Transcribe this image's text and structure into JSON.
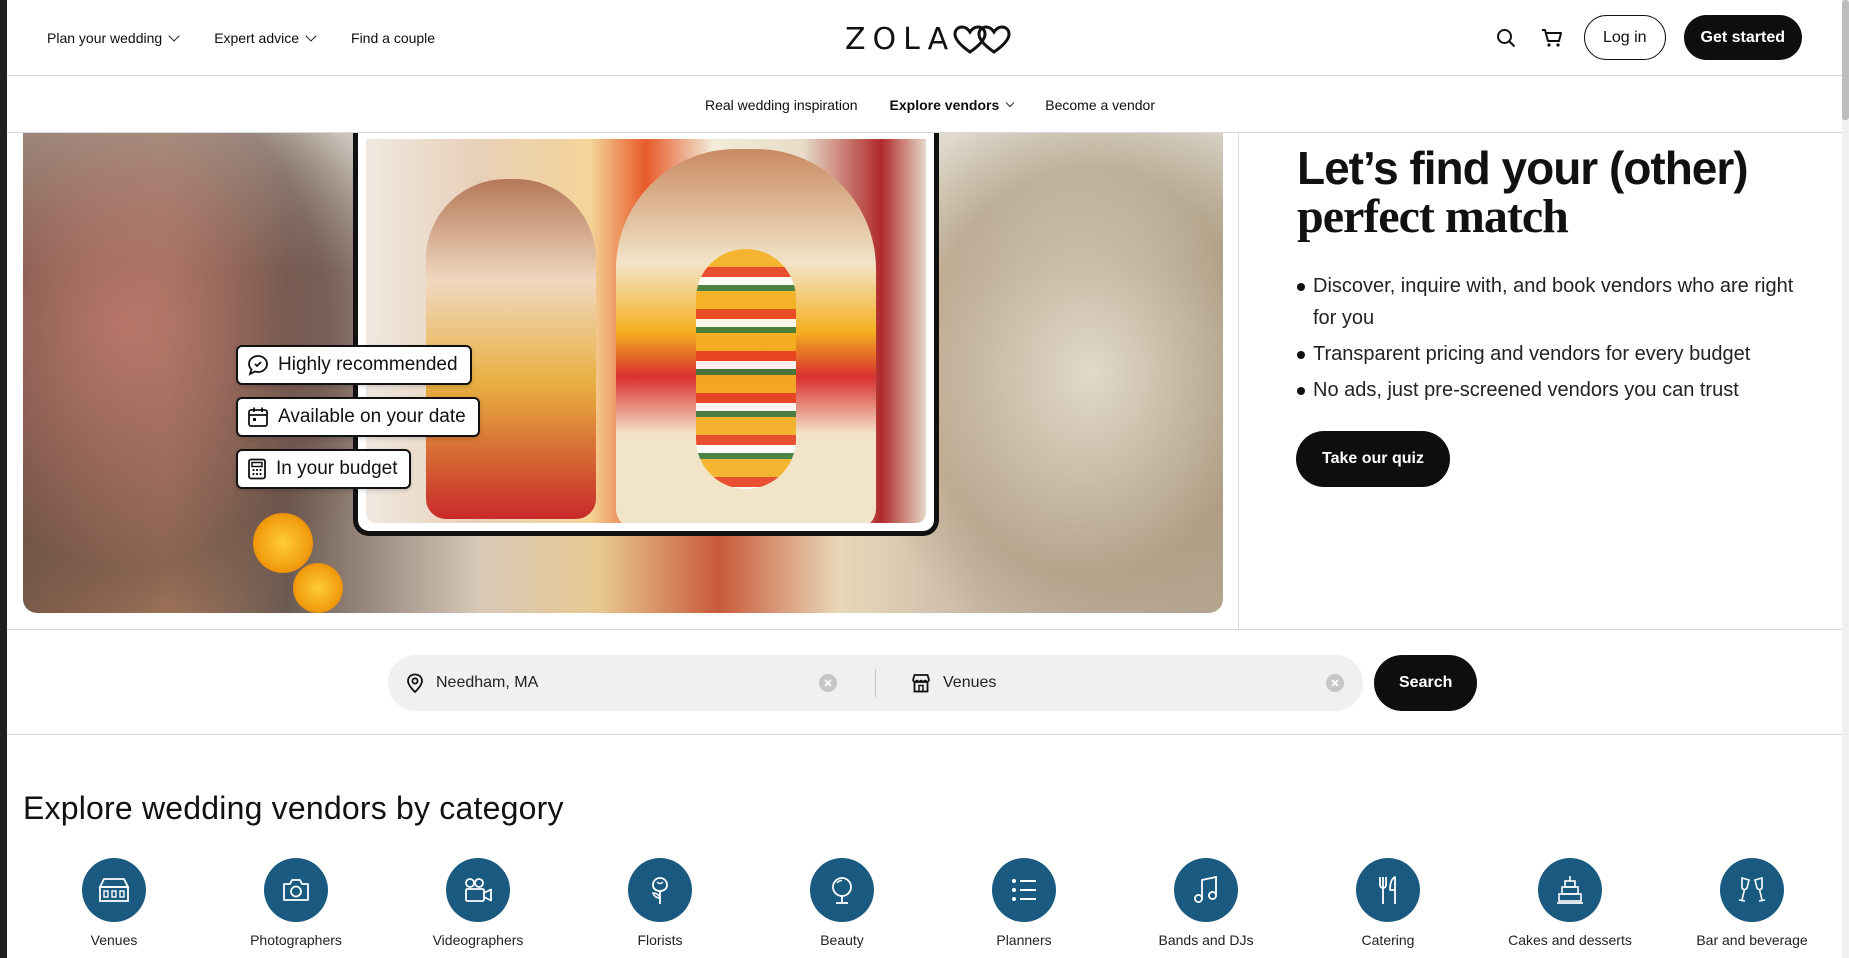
{
  "nav": {
    "plan": "Plan your wedding",
    "expert": "Expert advice",
    "find_couple": "Find a couple",
    "logo_text": "ZOLA",
    "login": "Log in",
    "get_started": "Get started",
    "icons": [
      "search-icon",
      "cart-icon"
    ]
  },
  "subnav": {
    "inspiration": "Real wedding inspiration",
    "explore": "Explore vendors",
    "become": "Become a vendor"
  },
  "hero": {
    "badges": [
      "Highly recommended",
      "Available on your date",
      "In your budget"
    ],
    "title_line1": "Let’s find your (other)",
    "title_line2": "perfect match",
    "bullets": [
      "Discover, inquire with, and book vendors who are right for you",
      "Transparent pricing and vendors for every budget",
      "No ads, just pre-screened vendors you can trust"
    ],
    "quiz_button": "Take our quiz"
  },
  "search": {
    "location_value": "Needham, MA",
    "category_value": "Venues",
    "button": "Search"
  },
  "categories": {
    "title": "Explore wedding vendors by category",
    "accent_color": "#1a5a80",
    "items": [
      {
        "label": "Venues",
        "icon": "venue-icon"
      },
      {
        "label": "Photographers",
        "icon": "camera-icon"
      },
      {
        "label": "Videographers",
        "icon": "video-camera-icon"
      },
      {
        "label": "Florists",
        "icon": "flower-icon"
      },
      {
        "label": "Beauty",
        "icon": "mirror-icon"
      },
      {
        "label": "Planners",
        "icon": "checklist-icon"
      },
      {
        "label": "Bands and DJs",
        "icon": "music-note-icon"
      },
      {
        "label": "Catering",
        "icon": "fork-knife-icon"
      },
      {
        "label": "Cakes and desserts",
        "icon": "cake-icon"
      },
      {
        "label": "Bar and beverage",
        "icon": "glasses-icon"
      }
    ]
  }
}
